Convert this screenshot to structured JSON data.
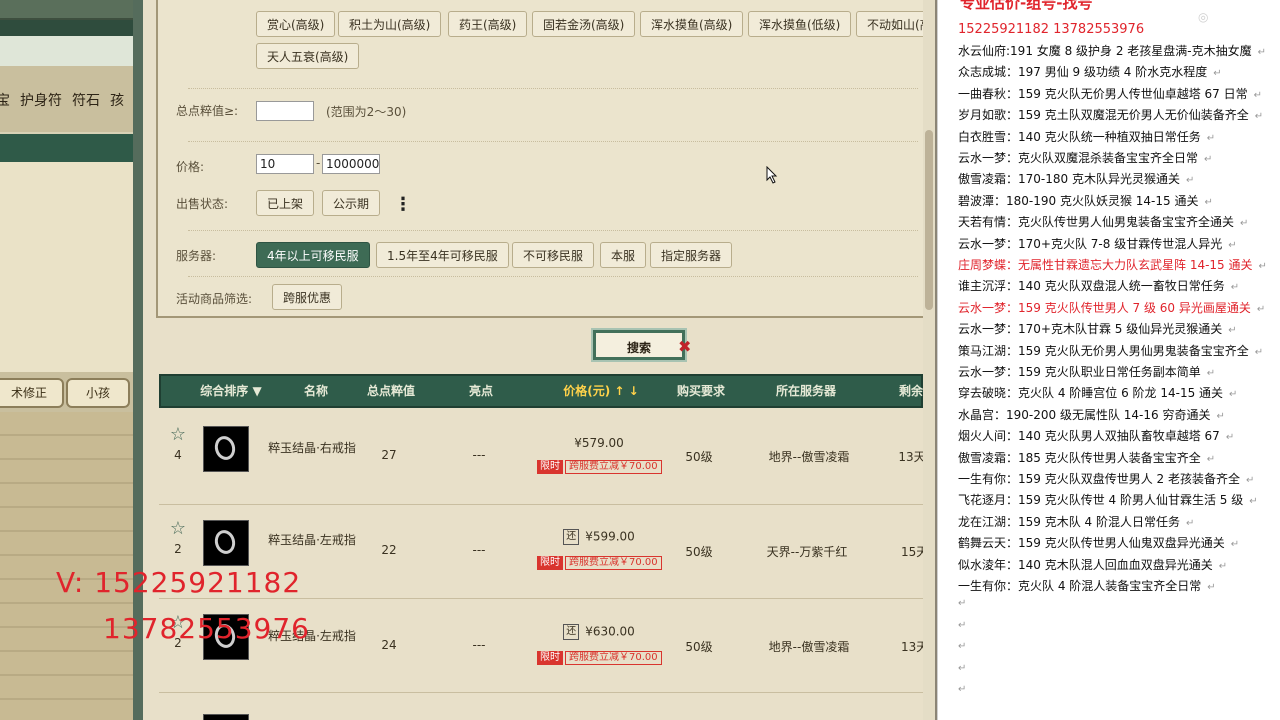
{
  "left_panel": {
    "tabs": [
      "宝",
      "护身符",
      "符石",
      "孩"
    ],
    "buttons": [
      "术修正",
      "小孩"
    ]
  },
  "filter": {
    "tag_chips": [
      "赏心(高级)",
      "积土为山(高级)",
      "药王(高级)",
      "固若金汤(高级)",
      "浑水摸鱼(高级)",
      "浑水摸鱼(低级)",
      "不动如山(高",
      "天人五衰(高级)"
    ],
    "total_label": "总点粹值≥:",
    "total_value": "",
    "total_hint": "(范围为2～30)",
    "price_label": "价格:",
    "price_min": "10",
    "price_dash": "-",
    "price_max": "1000000",
    "status_label": "出售状态:",
    "status_options": [
      "已上架",
      "公示期"
    ],
    "more_glyph": "⋮",
    "server_label": "服务器:",
    "server_options": [
      "4年以上可移民服",
      "1.5年至4年可移民服",
      "不可移民服",
      "本服",
      "指定服务器"
    ],
    "activity_label": "活动商品筛选:",
    "activity_option": "跨服优惠"
  },
  "search_button": "搜索",
  "search_close": "✖",
  "table": {
    "headers": {
      "sort": "综合排序 ▼",
      "name": "名称",
      "total": "总点粹值",
      "highlight": "亮点",
      "price": "价格(元) ↑ ↓",
      "requirement": "购买要求",
      "server": "所在服务器",
      "remain": "剩余"
    },
    "rows": [
      {
        "favorites": "4",
        "name": "粹玉结晶·右戒指",
        "total": "27",
        "highlight": "---",
        "price": "¥579.00",
        "has_return": false,
        "limit_tag": "限时",
        "discount": "跨服费立减￥70.00",
        "requirement": "50级",
        "server": "地界--傲雪凌霜",
        "remain": "13天"
      },
      {
        "favorites": "2",
        "name": "粹玉结晶·左戒指",
        "total": "22",
        "highlight": "---",
        "price": "¥599.00",
        "has_return": true,
        "return_glyph": "还",
        "limit_tag": "限时",
        "discount": "跨服费立减￥70.00",
        "requirement": "50级",
        "server": "天界--万紫千红",
        "remain": "15天"
      },
      {
        "favorites": "2",
        "name": "粹玉结晶·左戒指",
        "total": "24",
        "highlight": "---",
        "price": "¥630.00",
        "has_return": true,
        "return_glyph": "还",
        "limit_tag": "限时",
        "discount": "跨服费立减￥70.00",
        "requirement": "50级",
        "server": "地界--傲雪凌霜",
        "remain": "13天"
      }
    ]
  },
  "notes": {
    "header": "专业估价-组号-找号",
    "phones": "15225921182    13782553976",
    "return_mark": "↵",
    "lines": [
      {
        "text": "水云仙府:191 女魔 8 级护身 2 老孩星盘满-克木抽女魔",
        "red": false
      },
      {
        "text": "众志成城：197 男仙 9 级功绩 4 阶水克水程度",
        "red": false
      },
      {
        "text": "一曲春秋：159 克火队无价男人传世仙卓越塔 67 日常",
        "red": false
      },
      {
        "text": "岁月如歌：159 克土队双魔混无价男人无价仙装备齐全",
        "red": false
      },
      {
        "text": "白衣胜雪：140 克火队统一种植双抽日常任务",
        "red": false
      },
      {
        "text": "云水一梦：克火队双魔混杀装备宝宝齐全日常",
        "red": false
      },
      {
        "text": "傲雪凌霜：170-180 克木队异光灵猴通关",
        "red": false
      },
      {
        "text": "碧波潭：180-190 克火队妖灵猴 14-15 通关",
        "red": false
      },
      {
        "text": "天若有情：克火队传世男人仙男鬼装备宝宝齐全通关",
        "red": false
      },
      {
        "text": "云水一梦：170+克火队 7-8 级甘霖传世混人异光",
        "red": false
      },
      {
        "text": "庄周梦蝶：无属性甘霖遗忘大力队玄武星阵 14-15 通关",
        "red": true
      },
      {
        "text": "谁主沉浮：140 克火队双盘混人统一畜牧日常任务",
        "red": false
      },
      {
        "text": "云水一梦：159 克火队传世男人 7 级 60 异光画屋通关",
        "red": true
      },
      {
        "text": "云水一梦：170+克木队甘霖 5 级仙异光灵猴通关",
        "red": false
      },
      {
        "text": "策马江湖：159 克火队无价男人男仙男鬼装备宝宝齐全",
        "red": false
      },
      {
        "text": "云水一梦：159 克火队职业日常任务副本简单",
        "red": false
      },
      {
        "text": "穿去破晓：克火队 4 阶睡宫位 6 阶龙 14-15 通关",
        "red": false
      },
      {
        "text": "水晶宫：190-200 级无属性队 14-16 穷奇通关",
        "red": false
      },
      {
        "text": "烟火人间：140 克火队男人双抽队畜牧卓越塔 67",
        "red": false
      },
      {
        "text": "傲雪凌霜：185 克火队传世男人装备宝宝齐全",
        "red": false
      },
      {
        "text": "一生有你：159 克火队双盘传世男人 2 老孩装备齐全",
        "red": false
      },
      {
        "text": "飞花逐月：159 克火队传世 4 阶男人仙甘霖生活 5 级",
        "red": false
      },
      {
        "text": "龙在江湖：159 克木队 4 阶混人日常任务",
        "red": false
      },
      {
        "text": "鹤舞云天：159 克火队传世男人仙鬼双盘异光通关",
        "red": false
      },
      {
        "text": "似水淩年：140 克木队混人回血血双盘异光通关",
        "red": false
      },
      {
        "text": "一生有你：克火队 4 阶混人装备宝宝齐全日常",
        "red": false
      }
    ]
  },
  "overlay": {
    "line1": "V:  15225921182",
    "line2": "13782553976"
  },
  "colors": {
    "accent_green": "#3e6b55",
    "price_yellow": "#ffd24a",
    "alert_red": "#e0242c"
  }
}
